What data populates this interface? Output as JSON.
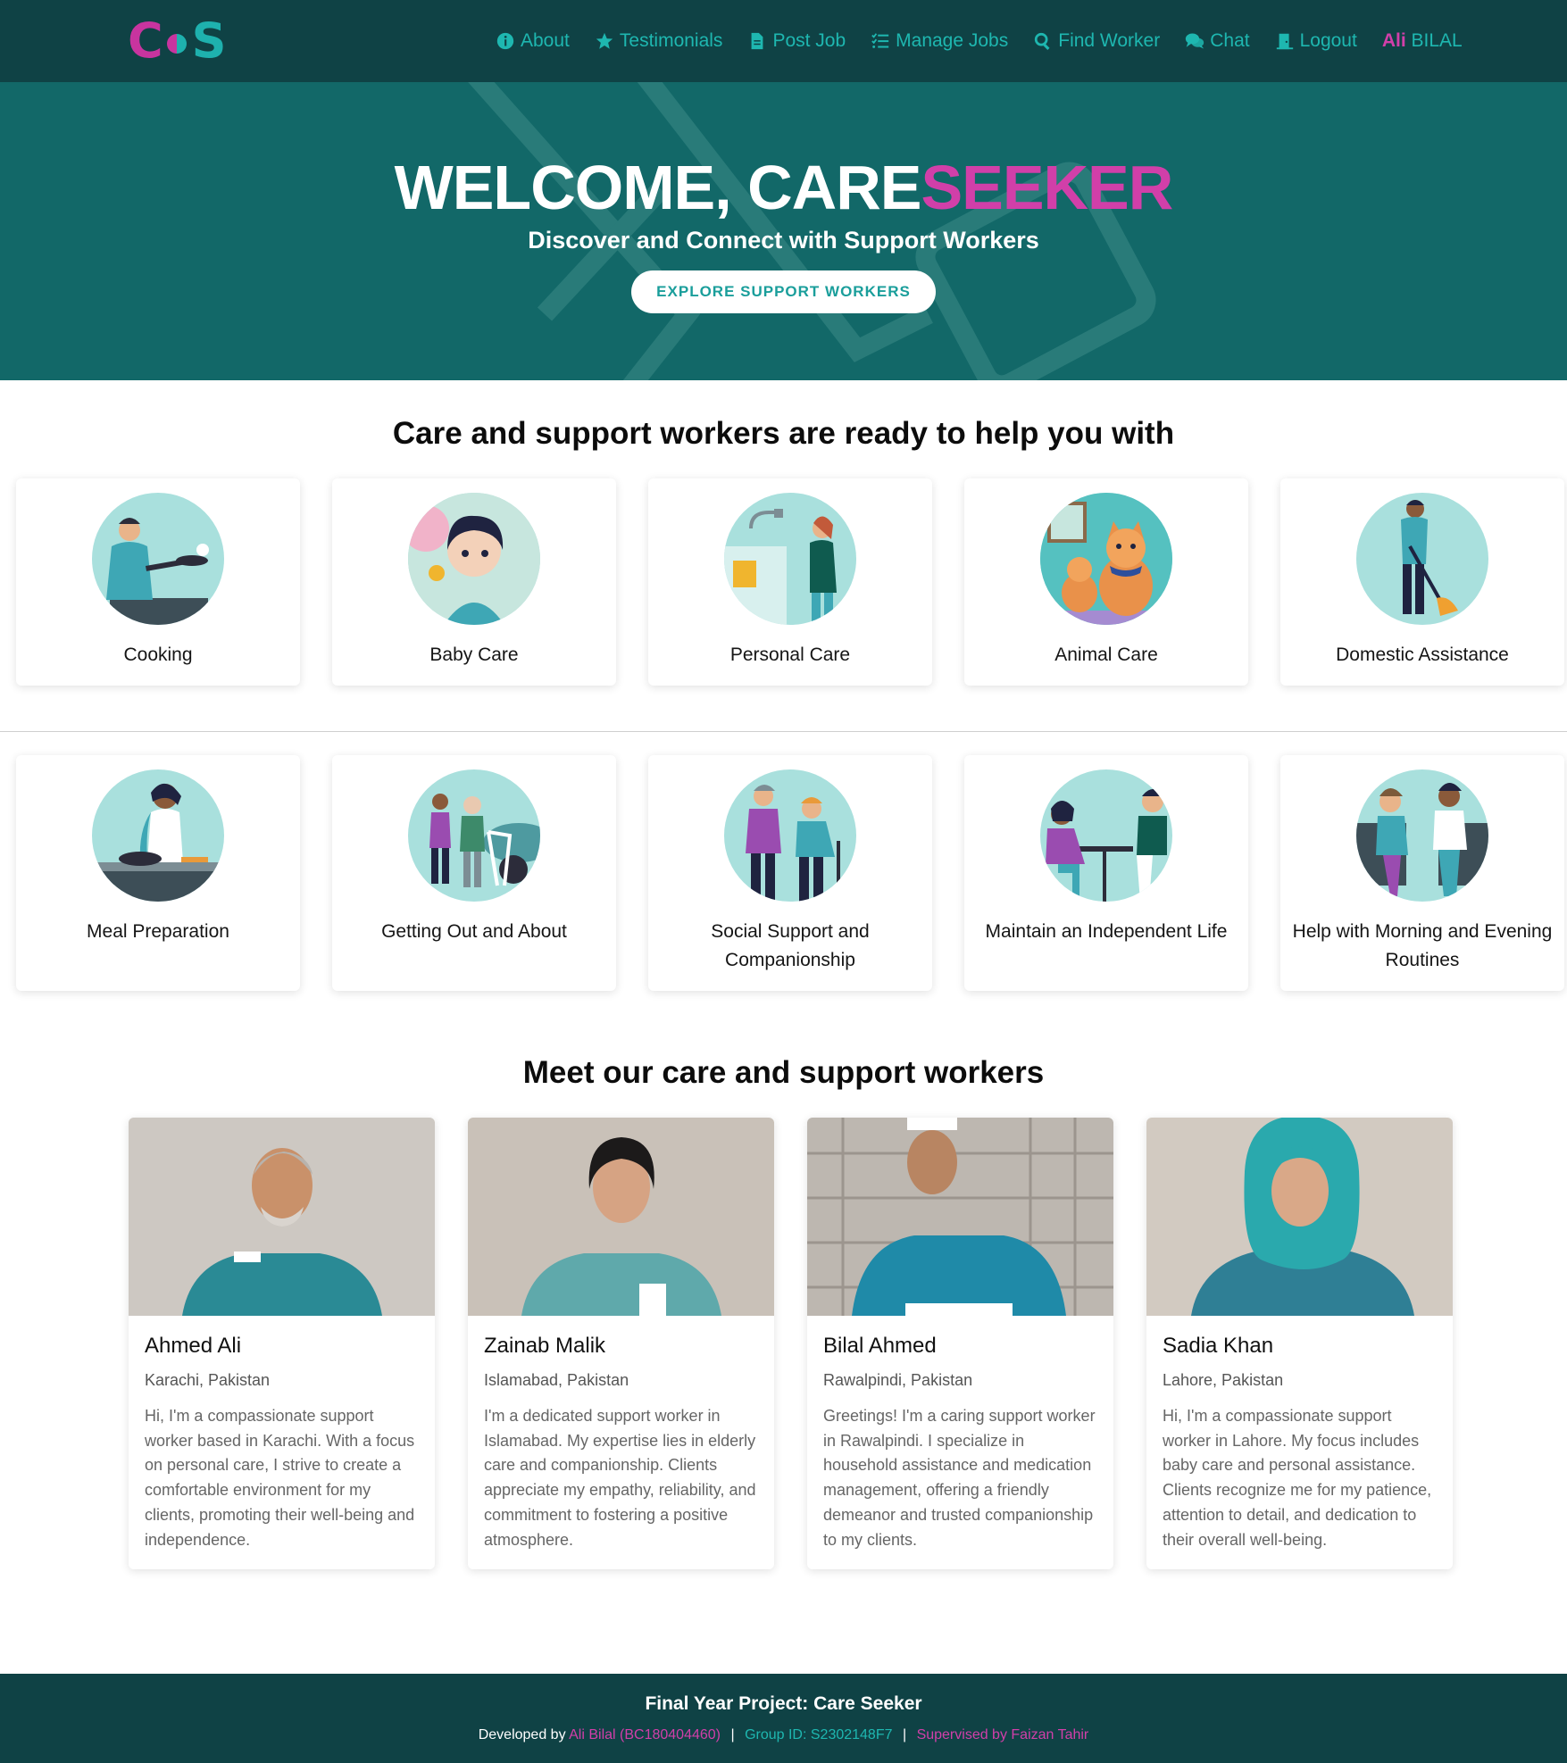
{
  "brand": {
    "logo_letters": [
      "C",
      "S"
    ],
    "colors": {
      "navbar": "#0f4245",
      "hero": "#126868",
      "pink": "#d13fa9",
      "teal": "#1eb7b0"
    }
  },
  "nav": {
    "items": [
      {
        "label": "About",
        "icon": "info-icon"
      },
      {
        "label": "Testimonials",
        "icon": "star-icon"
      },
      {
        "label": "Post Job",
        "icon": "file-icon"
      },
      {
        "label": "Manage Jobs",
        "icon": "list-check-icon"
      },
      {
        "label": "Find Worker",
        "icon": "search-icon"
      },
      {
        "label": "Chat",
        "icon": "chat-icon"
      },
      {
        "label": "Logout",
        "icon": "door-icon"
      }
    ],
    "user_first": "Ali",
    "user_last": "BILAL"
  },
  "hero": {
    "title_main": "WELCOME, CARE",
    "title_accent": "SEEKER",
    "subtitle": "Discover and Connect with Support Workers",
    "button": "EXPLORE SUPPORT WORKERS"
  },
  "services": {
    "title": "Care and support workers are ready to help you with",
    "row1": [
      {
        "label": "Cooking"
      },
      {
        "label": "Baby Care"
      },
      {
        "label": "Personal Care"
      },
      {
        "label": "Animal Care"
      },
      {
        "label": "Domestic Assistance"
      }
    ],
    "row2": [
      {
        "label": "Meal Preparation"
      },
      {
        "label": "Getting Out and About"
      },
      {
        "label": "Social Support and Companionship"
      },
      {
        "label": "Maintain an Independent Life"
      },
      {
        "label": "Help with Morning and Evening Routines"
      }
    ]
  },
  "workers": {
    "title": "Meet our care and support workers",
    "items": [
      {
        "name": "Ahmed Ali",
        "location": "Karachi, Pakistan",
        "bio": "Hi, I'm a compassionate support worker based in Karachi. With a focus on personal care, I strive to create a comfortable environment for my clients, promoting their well-being and independence."
      },
      {
        "name": "Zainab Malik",
        "location": "Islamabad, Pakistan",
        "bio": "I'm a dedicated support worker in Islamabad. My expertise lies in elderly care and companionship. Clients appreciate my empathy, reliability, and commitment to fostering a positive atmosphere."
      },
      {
        "name": "Bilal Ahmed",
        "location": "Rawalpindi, Pakistan",
        "bio": "Greetings! I'm a caring support worker in Rawalpindi. I specialize in household assistance and medication management, offering a friendly demeanor and trusted companionship to my clients."
      },
      {
        "name": "Sadia Khan",
        "location": "Lahore, Pakistan",
        "bio": "Hi, I'm a compassionate support worker in Lahore. My focus includes baby care and personal assistance. Clients recognize me for my patience, attention to detail, and dedication to their overall well-being."
      }
    ]
  },
  "footer": {
    "title": "Final Year Project: Care Seeker",
    "developed_prefix": "Developed by",
    "developer": "Ali Bilal (BC180404460)",
    "separator": "|",
    "group": "Group ID: S2302148F7",
    "supervisor": "Supervised by Faizan Tahir"
  }
}
